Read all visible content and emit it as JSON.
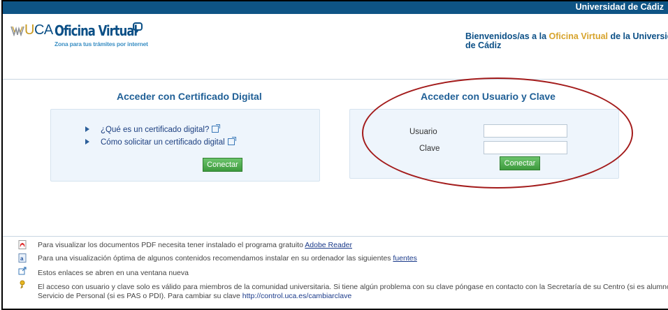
{
  "topbar": {
    "university": "Universidad de Cádiz"
  },
  "logo": {
    "uca_prefix": "U",
    "uca_rest": "CA",
    "title": "Oficina Virtual",
    "tagline": "Zona para tus trámites por internet"
  },
  "welcome": {
    "before": "Bienvenidos/as a la ",
    "highlight": "Oficina Virtual",
    "after": " de la Universidad",
    "line2": "de Cádiz"
  },
  "cert_panel": {
    "title": "Acceder con Certificado Digital",
    "links": [
      "¿Qué es un certificado digital?",
      "Cómo solicitar un certificado digital"
    ],
    "button": "Conectar"
  },
  "login_panel": {
    "title": "Acceder con Usuario y Clave",
    "user_label": "Usuario",
    "user_value": "",
    "password_label": "Clave",
    "password_value": "",
    "button": "Conectar"
  },
  "footer": {
    "pdf_text": "Para visualizar los documentos PDF necesita tener instalado el programa gratuito ",
    "pdf_link": "Adobe Reader",
    "fonts_text": "Para una visualización óptima de algunos contenidos recomendamos instalar en su ordenador las siguientes ",
    "fonts_link": "fuentes",
    "newwindow_text": "Estos enlaces se abren en una ventana nueva",
    "access_text_1": "El acceso con usuario y clave solo es válido para miembros de la comunidad universitaria. Si tiene algún problema con su clave póngase en contacto con la Secretaría de su Centro (si es alumno) o con el",
    "access_text_2": "Servicio de Personal (si es PAS o PDI). Para cambiar su clave ",
    "access_link": "http://control.uca.es/cambiarclave"
  },
  "colors": {
    "topbar": "#0e5485",
    "brand_blue": "#0b4f86",
    "gold": "#d7a32b",
    "button_green": "#4aa64a",
    "annotation_red": "#a31b1b"
  },
  "icons": [
    "pdf-icon",
    "fonts-icon",
    "external-link-icon",
    "key-icon",
    "bullet-arrow-icon"
  ]
}
